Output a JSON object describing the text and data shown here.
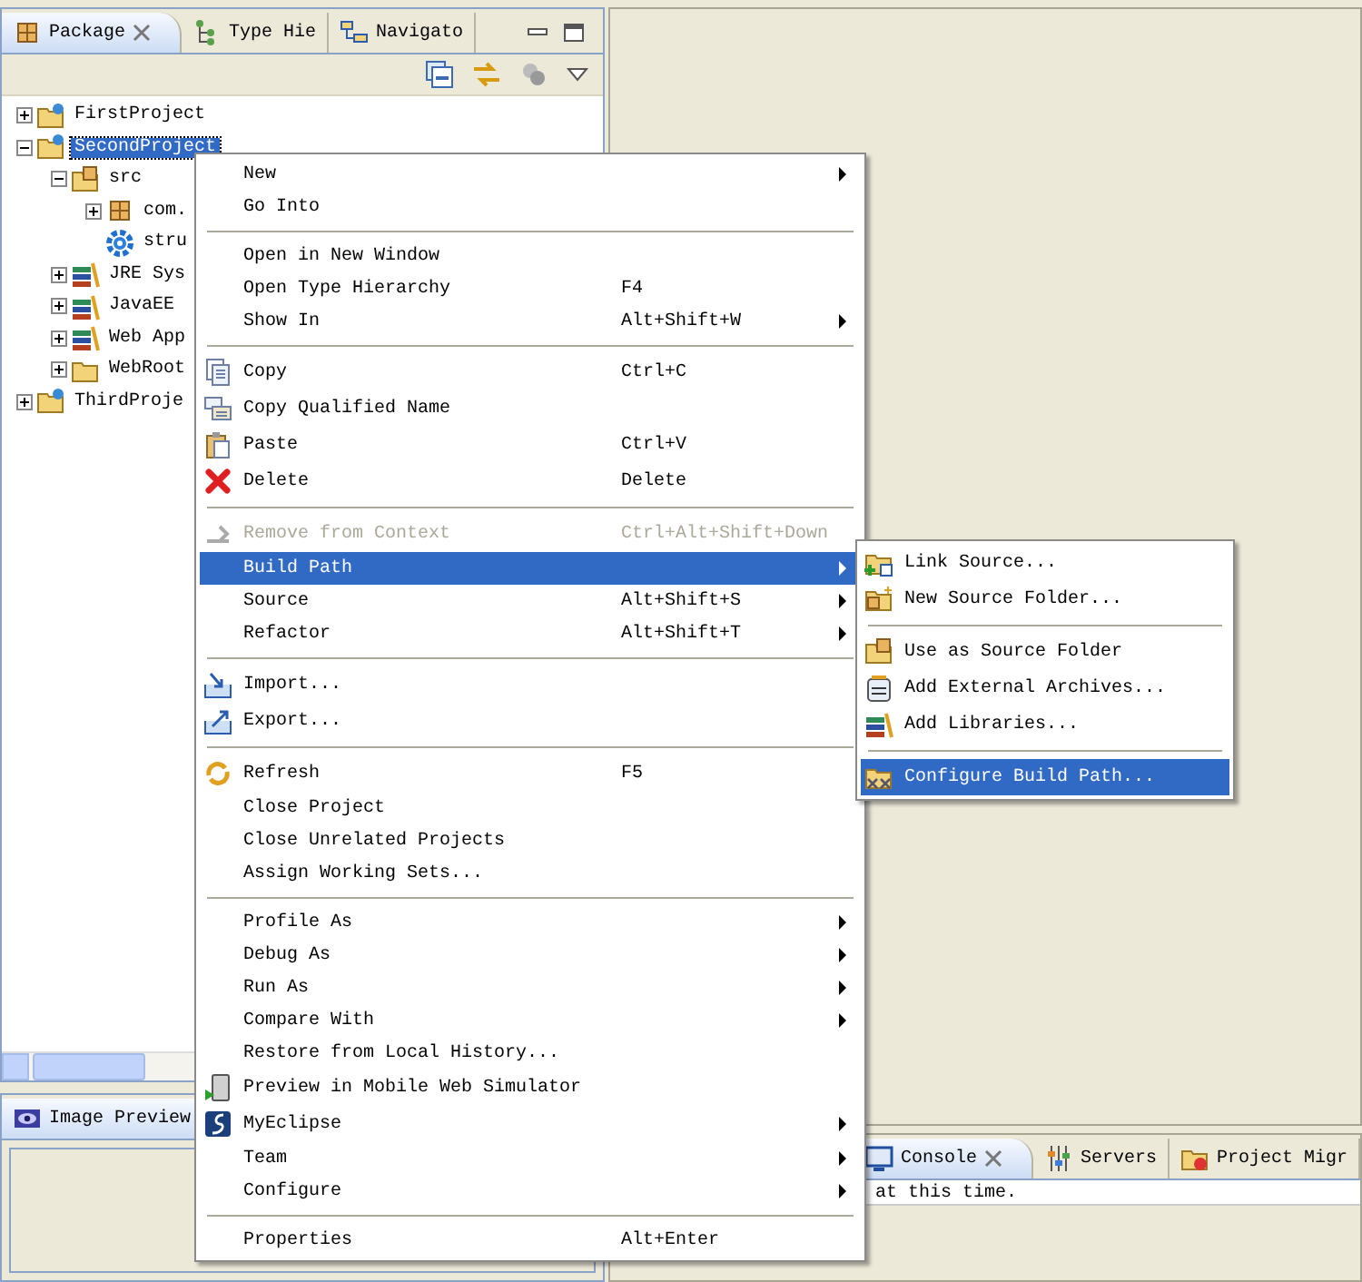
{
  "left_panel": {
    "tabs": [
      {
        "label": "Package",
        "kind": "package",
        "selected": true,
        "closable": true
      },
      {
        "label": "Type Hie",
        "kind": "hierarchy",
        "selected": false,
        "closable": false
      },
      {
        "label": "Navigato",
        "kind": "navigator",
        "selected": false,
        "closable": false
      }
    ],
    "tree": [
      {
        "label": "FirstProject",
        "kind": "project",
        "selected": false,
        "expanded": false
      },
      {
        "label": "SecondProject",
        "kind": "project",
        "selected": true,
        "expanded": true,
        "children": [
          {
            "label": "src",
            "kind": "source-folder",
            "selected": false,
            "expanded": true,
            "children": [
              {
                "label": "com.",
                "kind": "package",
                "selected": false,
                "expanded": false
              },
              {
                "label": "stru",
                "kind": "gear",
                "selected": false
              }
            ]
          },
          {
            "label": "JRE Sys",
            "kind": "library",
            "selected": false,
            "expanded": false
          },
          {
            "label": "JavaEE",
            "kind": "library",
            "selected": false,
            "expanded": false
          },
          {
            "label": "Web App",
            "kind": "library",
            "selected": false,
            "expanded": false
          },
          {
            "label": "WebRoot",
            "kind": "folder",
            "selected": false,
            "expanded": false
          }
        ]
      },
      {
        "label": "ThirdProje",
        "kind": "project",
        "selected": false,
        "expanded": false
      }
    ]
  },
  "image_preview_panel": {
    "tabs": [
      {
        "label": "Image Preview",
        "kind": "image",
        "selected": true
      }
    ]
  },
  "console_panel": {
    "tabs": [
      {
        "label": "Console",
        "kind": "console",
        "selected": true,
        "closable": true
      },
      {
        "label": "Servers",
        "kind": "servers",
        "selected": false,
        "closable": false
      },
      {
        "label": "Project Migr",
        "kind": "migration",
        "selected": false,
        "closable": false
      }
    ],
    "message": "at this time."
  },
  "context_menu": {
    "groups": [
      [
        {
          "label": "New",
          "kind": "plain",
          "submenu": true,
          "disabled": false,
          "selected": false
        },
        {
          "label": "Go Into",
          "kind": "plain",
          "submenu": false,
          "disabled": false,
          "selected": false
        }
      ],
      [
        {
          "label": "Open in New Window",
          "kind": "plain",
          "submenu": false,
          "disabled": false,
          "selected": false
        },
        {
          "label": "Open Type Hierarchy",
          "shortcut": "F4",
          "kind": "plain",
          "submenu": false,
          "disabled": false,
          "selected": false
        },
        {
          "label": "Show In",
          "shortcut": "Alt+Shift+W",
          "kind": "plain",
          "submenu": true,
          "disabled": false,
          "selected": false
        }
      ],
      [
        {
          "label": "Copy",
          "shortcut": "Ctrl+C",
          "kind": "copy",
          "submenu": false,
          "disabled": false,
          "selected": false
        },
        {
          "label": "Copy Qualified Name",
          "kind": "copy-name",
          "submenu": false,
          "disabled": false,
          "selected": false
        },
        {
          "label": "Paste",
          "shortcut": "Ctrl+V",
          "kind": "paste",
          "submenu": false,
          "disabled": false,
          "selected": false
        },
        {
          "label": "Delete",
          "shortcut": "Delete",
          "kind": "delete",
          "submenu": false,
          "disabled": false,
          "selected": false
        }
      ],
      [
        {
          "label": "Remove from Context",
          "shortcut": "Ctrl+Alt+Shift+Down",
          "kind": "remove",
          "submenu": false,
          "disabled": true,
          "selected": false
        },
        {
          "label": "Build Path",
          "kind": "plain",
          "submenu": true,
          "disabled": false,
          "selected": true
        },
        {
          "label": "Source",
          "shortcut": "Alt+Shift+S",
          "kind": "plain",
          "submenu": true,
          "disabled": false,
          "selected": false
        },
        {
          "label": "Refactor",
          "shortcut": "Alt+Shift+T",
          "kind": "plain",
          "submenu": true,
          "disabled": false,
          "selected": false
        }
      ],
      [
        {
          "label": "Import...",
          "kind": "import",
          "submenu": false,
          "disabled": false,
          "selected": false
        },
        {
          "label": "Export...",
          "kind": "export",
          "submenu": false,
          "disabled": false,
          "selected": false
        }
      ],
      [
        {
          "label": "Refresh",
          "shortcut": "F5",
          "kind": "refresh",
          "submenu": false,
          "disabled": false,
          "selected": false
        },
        {
          "label": "Close Project",
          "kind": "plain",
          "submenu": false,
          "disabled": false,
          "selected": false
        },
        {
          "label": "Close Unrelated Projects",
          "kind": "plain",
          "submenu": false,
          "disabled": false,
          "selected": false
        },
        {
          "label": "Assign Working Sets...",
          "kind": "plain",
          "submenu": false,
          "disabled": false,
          "selected": false
        }
      ],
      [
        {
          "label": "Profile As",
          "kind": "plain",
          "submenu": true,
          "disabled": false,
          "selected": false
        },
        {
          "label": "Debug As",
          "kind": "plain",
          "submenu": true,
          "disabled": false,
          "selected": false
        },
        {
          "label": "Run As",
          "kind": "plain",
          "submenu": true,
          "disabled": false,
          "selected": false
        },
        {
          "label": "Compare With",
          "kind": "plain",
          "submenu": true,
          "disabled": false,
          "selected": false
        },
        {
          "label": "Restore from Local History...",
          "kind": "plain",
          "submenu": false,
          "disabled": false,
          "selected": false
        },
        {
          "label": "Preview in Mobile Web Simulator",
          "kind": "preview",
          "submenu": false,
          "disabled": false,
          "selected": false
        },
        {
          "label": "MyEclipse",
          "kind": "myeclipse",
          "submenu": true,
          "disabled": false,
          "selected": false
        },
        {
          "label": "Team",
          "kind": "plain",
          "submenu": true,
          "disabled": false,
          "selected": false
        },
        {
          "label": "Configure",
          "kind": "plain",
          "submenu": true,
          "disabled": false,
          "selected": false
        }
      ],
      [
        {
          "label": "Properties",
          "shortcut": "Alt+Enter",
          "kind": "plain",
          "submenu": false,
          "disabled": false,
          "selected": false
        }
      ]
    ]
  },
  "submenu": {
    "groups": [
      [
        {
          "label": "Link Source...",
          "kind": "link-source",
          "submenu": false,
          "disabled": false,
          "selected": false
        },
        {
          "label": "New Source Folder...",
          "kind": "new-source-folder",
          "submenu": false,
          "disabled": false,
          "selected": false
        }
      ],
      [
        {
          "label": "Use as Source Folder",
          "kind": "source-folder",
          "submenu": false,
          "disabled": false,
          "selected": false
        },
        {
          "label": "Add External Archives...",
          "kind": "archive",
          "submenu": false,
          "disabled": false,
          "selected": false
        },
        {
          "label": "Add Libraries...",
          "kind": "library",
          "submenu": false,
          "disabled": false,
          "selected": false
        }
      ],
      [
        {
          "label": "Configure Build Path...",
          "kind": "configure",
          "submenu": false,
          "disabled": false,
          "selected": true
        }
      ]
    ]
  }
}
